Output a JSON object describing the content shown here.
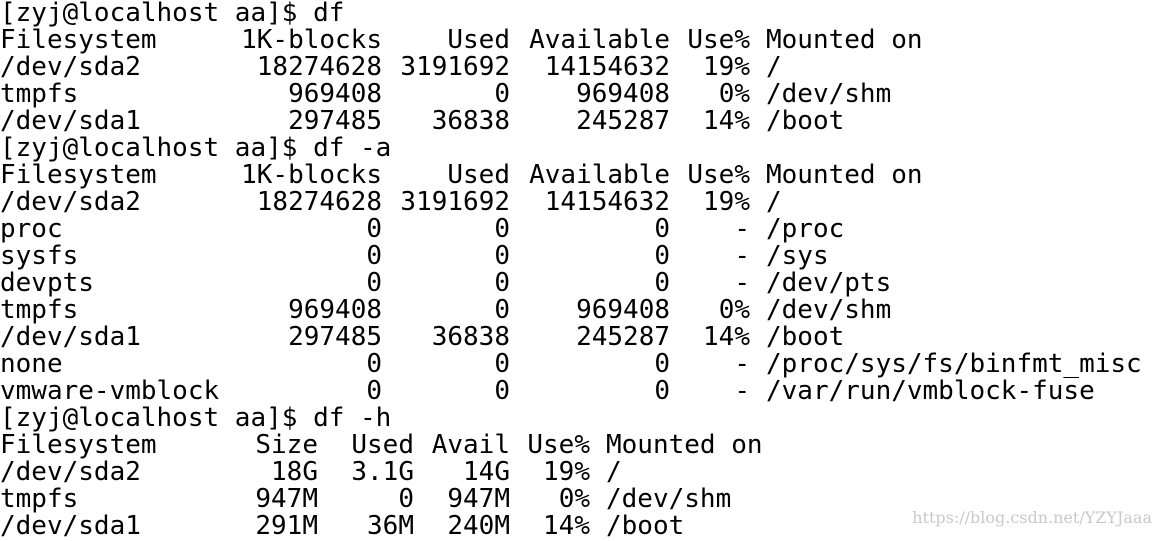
{
  "terminal": {
    "block1": {
      "prompt": "[zyj@localhost aa]$ df",
      "headers": [
        "Filesystem",
        "1K-blocks",
        "Used",
        "Available",
        "Use%",
        "Mounted on"
      ],
      "rows": [
        [
          "/dev/sda2",
          "18274628",
          "3191692",
          "14154632",
          "19%",
          "/"
        ],
        [
          "tmpfs",
          "969408",
          "0",
          "969408",
          "0%",
          "/dev/shm"
        ],
        [
          "/dev/sda1",
          "297485",
          "36838",
          "245287",
          "14%",
          "/boot"
        ]
      ]
    },
    "block2": {
      "prompt": "[zyj@localhost aa]$ df -a",
      "headers": [
        "Filesystem",
        "1K-blocks",
        "Used",
        "Available",
        "Use%",
        "Mounted on"
      ],
      "rows": [
        [
          "/dev/sda2",
          "18274628",
          "3191692",
          "14154632",
          "19%",
          "/"
        ],
        [
          "proc",
          "0",
          "0",
          "0",
          "-",
          "/proc"
        ],
        [
          "sysfs",
          "0",
          "0",
          "0",
          "-",
          "/sys"
        ],
        [
          "devpts",
          "0",
          "0",
          "0",
          "-",
          "/dev/pts"
        ],
        [
          "tmpfs",
          "969408",
          "0",
          "969408",
          "0%",
          "/dev/shm"
        ],
        [
          "/dev/sda1",
          "297485",
          "36838",
          "245287",
          "14%",
          "/boot"
        ],
        [
          "none",
          "0",
          "0",
          "0",
          "-",
          "/proc/sys/fs/binfmt_misc"
        ],
        [
          "vmware-vmblock",
          "0",
          "0",
          "0",
          "-",
          "/var/run/vmblock-fuse"
        ]
      ]
    },
    "block3": {
      "prompt": "[zyj@localhost aa]$ df -h",
      "headers": [
        "Filesystem",
        "Size",
        "Used",
        "Avail",
        "Use%",
        "Mounted on"
      ],
      "rows": [
        [
          "/dev/sda2",
          "18G",
          "3.1G",
          "14G",
          "19%",
          "/"
        ],
        [
          "tmpfs",
          "947M",
          "0",
          "947M",
          "0%",
          "/dev/shm"
        ],
        [
          "/dev/sda1",
          "291M",
          "36M",
          "240M",
          "14%",
          "/boot"
        ]
      ]
    }
  },
  "watermark": "https://blog.csdn.net/YZYJaaa"
}
